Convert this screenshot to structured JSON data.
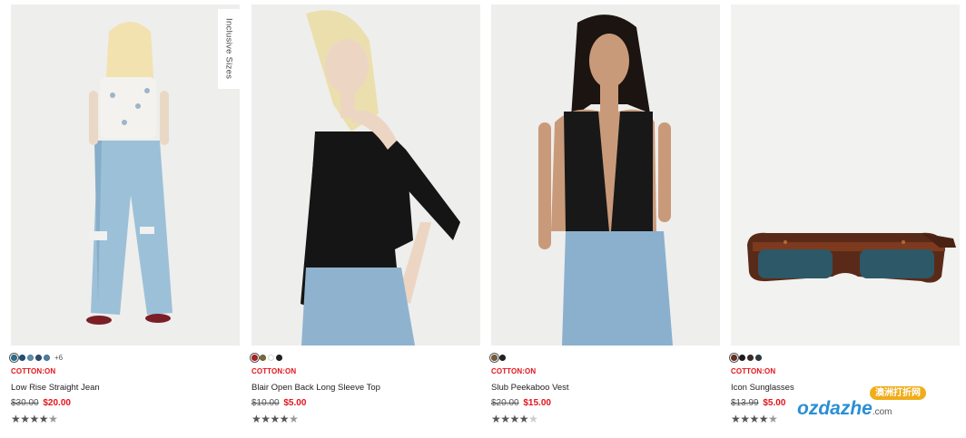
{
  "products": [
    {
      "brand": "COTTON:ON",
      "name": "Low Rise Straight Jean",
      "price_was": "$30.00",
      "price_now": "$20.00",
      "badge": "Inclusive Sizes",
      "swatches": [
        "#2b6f8f",
        "#1f4f7a",
        "#5f8fb0",
        "#2a4d73",
        "#4d7ea3"
      ],
      "more_colors": "+6",
      "rating": 4.5
    },
    {
      "brand": "COTTON:ON",
      "name": "Blair Open Back Long Sleeve Top",
      "price_was": "$10.00",
      "price_now": "$5.00",
      "swatches": [
        "#b01f24",
        "#7a6a3a",
        "#ffffff",
        "#222222"
      ],
      "rating": 4.5
    },
    {
      "brand": "COTTON:ON",
      "name": "Slub Peekaboo Vest",
      "price_was": "$20.00",
      "price_now": "$15.00",
      "swatches": [
        "#7a5a3a",
        "#222222"
      ],
      "rating": 4
    },
    {
      "brand": "COTTON:ON",
      "name": "Icon Sunglasses",
      "price_was": "$13.99",
      "price_now": "$5.00",
      "swatches": [
        "#6b2f1f",
        "#1c1c1c",
        "#3b2a2a",
        "#2d3a40"
      ],
      "rating": 4.5
    }
  ],
  "watermark": {
    "cn": "澳洲打折网",
    "text": "ozdazhe",
    "domain": ".com"
  },
  "colors": {
    "brand_red": "#e3131b",
    "accent_blue": "#2a8fd6"
  }
}
